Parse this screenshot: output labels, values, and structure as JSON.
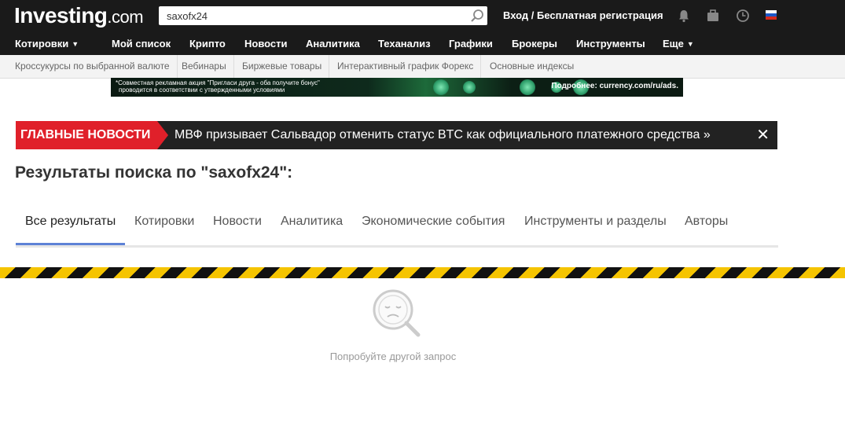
{
  "header": {
    "logo_main": "Investing",
    "logo_suffix": ".com",
    "search_value": "saxofx24",
    "login": "Вход",
    "separator": "/",
    "register": "Бесплатная регистрация"
  },
  "mainnav": {
    "items": [
      "Котировки",
      "Мой список",
      "Крипто",
      "Новости",
      "Аналитика",
      "Теханализ",
      "Графики",
      "Брокеры",
      "Инструменты",
      "Еще"
    ]
  },
  "subnav": {
    "items": [
      "Кроссукурсы по выбранной валюте",
      "Вебинары",
      "Биржевые товары",
      "Интерактивный график Форекс",
      "Основные индексы"
    ]
  },
  "ad": {
    "line1": "*Совместная рекламная акция \"Пригласи друга - оба получите бонус\"",
    "line2": "проводится в соответствии с утвержденными условиями",
    "cta": "Подробнее: currency.com/ru/ads."
  },
  "breaking": {
    "label": "ГЛАВНЫЕ НОВОСТИ",
    "headline": "МВФ призывает Сальвадор отменить статус BTC как официального платежного средства »",
    "close": "✕"
  },
  "results": {
    "title": "Результаты поиска по \"saxofx24\":"
  },
  "tabs": [
    "Все результаты",
    "Котировки",
    "Новости",
    "Аналитика",
    "Экономические события",
    "Инструменты и разделы",
    "Авторы"
  ],
  "empty": {
    "message": "Попробуйте другой запрос"
  },
  "colors": {
    "header_bg": "#1a1a1a",
    "breaking_red": "#e0202a",
    "tab_active": "#5d82d6",
    "hazard_yellow": "#f5c400"
  }
}
